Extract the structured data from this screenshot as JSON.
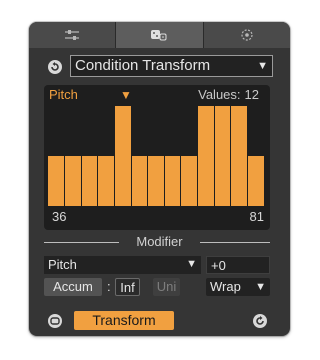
{
  "tabs": [
    {
      "icon": "sliders-icon",
      "active": false
    },
    {
      "icon": "dice-icon",
      "active": true
    },
    {
      "icon": "target-icon",
      "active": false
    }
  ],
  "header": {
    "transform_type": "Condition Transform"
  },
  "chart": {
    "property": "Pitch",
    "values_label": "Values:",
    "values_count": "12",
    "range_min": "36",
    "range_max": "81"
  },
  "chart_data": {
    "type": "bar",
    "x": [
      1,
      2,
      3,
      4,
      5,
      6,
      7,
      8,
      9,
      10,
      11,
      12
    ],
    "values": [
      0.5,
      0.5,
      0.5,
      0.5,
      1.0,
      0.5,
      0.5,
      0.5,
      0.5,
      1.0,
      1.0,
      1.0,
      0.5
    ],
    "ylim": [
      0,
      1
    ],
    "color": "#f1a040"
  },
  "modifier": {
    "section_label": "Modifier",
    "property": "Pitch",
    "offset": "+0",
    "accum_label": "Accum",
    "colon": ":",
    "inf_label": "Inf",
    "uni_label": "Uni",
    "wrap_label": "Wrap"
  },
  "footer": {
    "transform_label": "Transform"
  },
  "colors": {
    "accent": "#f1a040",
    "panel": "#353535",
    "field": "#222222"
  }
}
